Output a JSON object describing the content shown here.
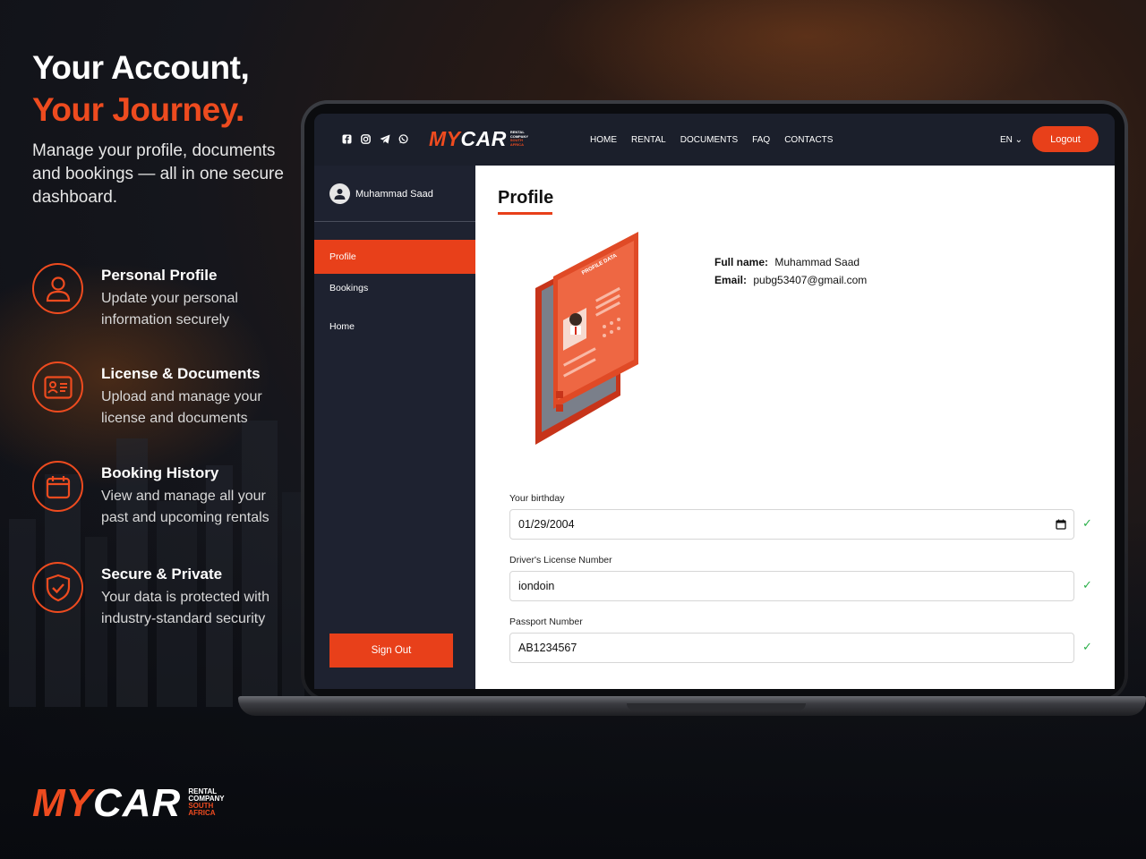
{
  "hero": {
    "title_line1": "Your Account,",
    "title_line2": "Your Journey.",
    "subtitle": "Manage your profile, documents and bookings — all in one secure dashboard."
  },
  "features": [
    {
      "icon": "user-icon",
      "title": "Personal Profile",
      "description": "Update your personal information securely"
    },
    {
      "icon": "id-card-icon",
      "title": "License & Documents",
      "description": "Upload and manage your license and documents"
    },
    {
      "icon": "calendar-icon",
      "title": "Booking History",
      "description": "View and manage all your past and upcoming rentals"
    },
    {
      "icon": "shield-check-icon",
      "title": "Secure & Private",
      "description": "Your data is protected with industry-standard security"
    }
  ],
  "brand": {
    "name_prefix": "MY",
    "name_suffix": "CAR",
    "tag_line1": "RENTAL",
    "tag_line2": "COMPANY",
    "tag_line3": "SOUTH",
    "tag_line4": "AFRICA"
  },
  "topbar": {
    "socials": [
      "facebook-icon",
      "instagram-icon",
      "telegram-icon",
      "whatsapp-icon"
    ],
    "nav": [
      "HOME",
      "RENTAL",
      "DOCUMENTS",
      "FAQ",
      "CONTACTS"
    ],
    "language": "EN ⌄",
    "logout_label": "Logout"
  },
  "sidebar": {
    "user_name": "Muhammad Saad",
    "items": [
      {
        "label": "Profile",
        "active": true
      },
      {
        "label": "Bookings",
        "active": false
      },
      {
        "label": "Home",
        "active": false
      }
    ],
    "signout_label": "Sign Out"
  },
  "profile": {
    "title": "Profile",
    "illustration_label": "PROFILE DATA",
    "full_name_label": "Full name:",
    "full_name": "Muhammad Saad",
    "email_label": "Email:",
    "email": "pubg53407@gmail.com",
    "fields": [
      {
        "label": "Your birthday",
        "value": "01/29/2004"
      },
      {
        "label": "Driver's License Number",
        "value": "iondoin"
      },
      {
        "label": "Passport Number",
        "value": "AB1234567"
      }
    ],
    "check_mark": "✓"
  },
  "colors": {
    "accent": "#e8401a",
    "dark": "#1e2230",
    "success": "#2bb04a"
  }
}
